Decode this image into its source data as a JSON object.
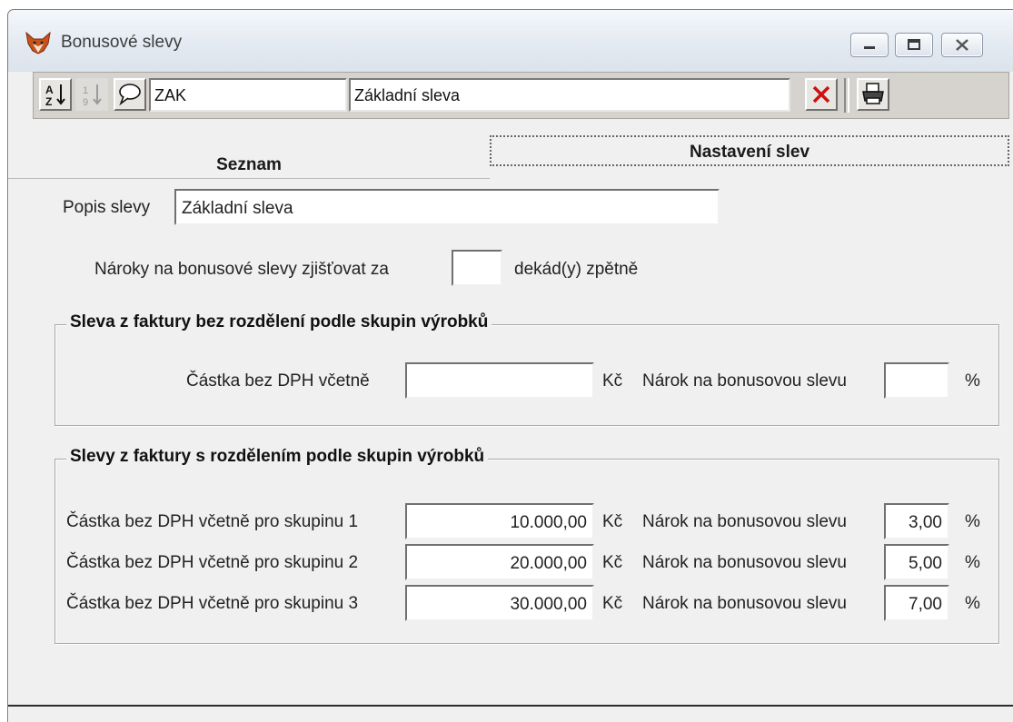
{
  "window": {
    "title": "Bonusové slevy"
  },
  "toolbar": {
    "code": "ZAK",
    "name": "Základní sleva"
  },
  "tabs": [
    {
      "label": "Seznam"
    },
    {
      "label": "Nastavení slev"
    }
  ],
  "form": {
    "description_label": "Popis slevy",
    "description_value": "Základní sleva",
    "decades_label": "Nároky na bonusové slevy zjišťovat za",
    "decades_value": "",
    "decades_suffix": "dekád(y) zpětně"
  },
  "group1": {
    "title": "Sleva z faktury bez rozdělení podle skupin výrobků",
    "amount_label": "Částka bez DPH včetně",
    "amount_value": "",
    "currency": "Kč",
    "claim_label": "Nárok na bonusovou slevu",
    "claim_value": "",
    "percent": "%"
  },
  "group2": {
    "title": "Slevy z faktury s rozdělením podle skupin výrobků",
    "rows": [
      {
        "label": "Částka bez DPH včetně pro skupinu 1",
        "amount": "10.000,00",
        "currency": "Kč",
        "claim_label": "Nárok na bonusovou slevu",
        "claim": "3,00",
        "percent": "%"
      },
      {
        "label": "Částka bez DPH včetně pro skupinu 2",
        "amount": "20.000,00",
        "currency": "Kč",
        "claim_label": "Nárok na bonusovou slevu",
        "claim": "5,00",
        "percent": "%"
      },
      {
        "label": "Částka bez DPH včetně pro skupinu 3",
        "amount": "30.000,00",
        "currency": "Kč",
        "claim_label": "Nárok na bonusovou slevu",
        "claim": "7,00",
        "percent": "%"
      }
    ]
  }
}
